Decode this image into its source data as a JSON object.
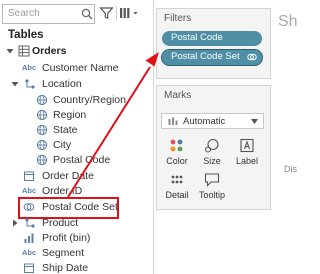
{
  "colors": {
    "pill": "#4e8fa6",
    "highlight": "#e0101a",
    "shelf_background": "#f4f4f4",
    "field_icon": "#5b7fa6"
  },
  "data_pane": {
    "search_placeholder": "Search",
    "tables_heading": "Tables",
    "fields": [
      {
        "label": "Orders",
        "icon": "table-icon",
        "expanded": true
      },
      {
        "label": "Customer Name",
        "icon": "abc-string-icon",
        "type_text": "Abc"
      },
      {
        "label": "Location",
        "icon": "hierarchy-icon",
        "expanded": true
      },
      {
        "label": "Country/Region",
        "icon": "globe-icon"
      },
      {
        "label": "Region",
        "icon": "globe-icon"
      },
      {
        "label": "State",
        "icon": "globe-icon"
      },
      {
        "label": "City",
        "icon": "globe-icon"
      },
      {
        "label": "Postal Code",
        "icon": "globe-icon"
      },
      {
        "label": "Order Date",
        "icon": "calendar-icon"
      },
      {
        "label": "Order ID",
        "icon": "abc-string-icon",
        "type_text": "Abc"
      },
      {
        "label": "Postal Code Set",
        "icon": "set-icon",
        "highlighted": true
      },
      {
        "label": "Product",
        "icon": "hierarchy-icon",
        "expanded": false
      },
      {
        "label": "Profit (bin)",
        "icon": "bin-icon"
      },
      {
        "label": "Segment",
        "icon": "abc-string-icon",
        "type_text": "Abc"
      },
      {
        "label": "Ship Date",
        "icon": "calendar-icon"
      }
    ]
  },
  "filters": {
    "title": "Filters",
    "pills": [
      {
        "label": "Postal Code"
      },
      {
        "label": "Postal Code Set",
        "icon": "set-icon"
      }
    ]
  },
  "marks": {
    "title": "Marks",
    "mark_type": "Automatic",
    "buttons": [
      {
        "label": "Color",
        "icon": "color-dots-icon"
      },
      {
        "label": "Size",
        "icon": "size-icon"
      },
      {
        "label": "Label",
        "icon": "label-icon"
      },
      {
        "label": "Detail",
        "icon": "detail-dots-icon"
      },
      {
        "label": "Tooltip",
        "icon": "tooltip-icon"
      }
    ]
  },
  "canvas": {
    "partial_title": "Sh",
    "partial_text": "Dis"
  }
}
